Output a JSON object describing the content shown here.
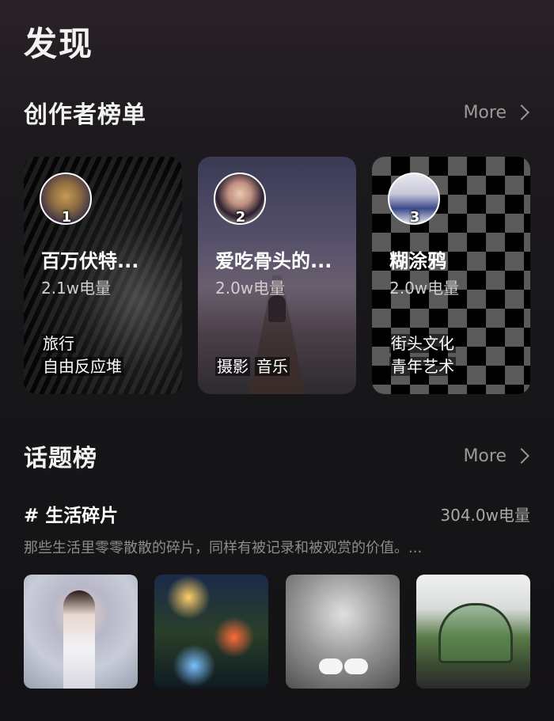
{
  "page": {
    "title": "发现"
  },
  "creators": {
    "title": "创作者榜单",
    "more_label": "More",
    "cards": [
      {
        "rank": "1",
        "name": "百万伏特...",
        "energy": "2.1w电量",
        "tags": [
          "旅行",
          "自由反应堆"
        ]
      },
      {
        "rank": "2",
        "name": "爱吃骨头的...",
        "energy": "2.0w电量",
        "tags": [
          "摄影",
          "音乐"
        ]
      },
      {
        "rank": "3",
        "name": "糊涂鸦",
        "energy": "2.0w电量",
        "tags": [
          "街头文化",
          "青年艺术"
        ]
      }
    ]
  },
  "topics": {
    "title": "话题榜",
    "more_label": "More",
    "item": {
      "name": "# 生活碎片",
      "energy": "304.0w电量",
      "description": "那些生活里零零散散的碎片，同样有被记录和被观赏的价值。...",
      "thumbnails": [
        "girl-umbrella-photo",
        "city-night-photo",
        "snowy-feet-photo",
        "garden-dome-photo"
      ]
    }
  }
}
